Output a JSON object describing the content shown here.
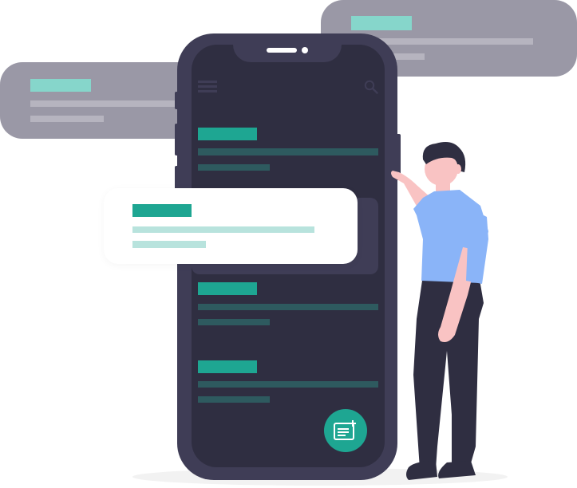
{
  "colors": {
    "teal": "#1ea692",
    "teal_light": "#86d6cb",
    "teal_pale": "#b8e3dd",
    "frame": "#3f3d56",
    "screen": "#2f2e41",
    "bg_card": "#9a98a6",
    "bg_card_line": "#b6b4bf",
    "row_line": "#2e5a5f",
    "shirt": "#8ab4f8",
    "skin": "#f9c3c3",
    "pants": "#2f2e41",
    "hair": "#2f2e41",
    "shadow": "#f2f2f2"
  },
  "icons": {
    "menu": "hamburger-menu-icon",
    "search": "search-icon",
    "fab": "add-note-icon"
  },
  "phone": {
    "list_items": 3
  }
}
